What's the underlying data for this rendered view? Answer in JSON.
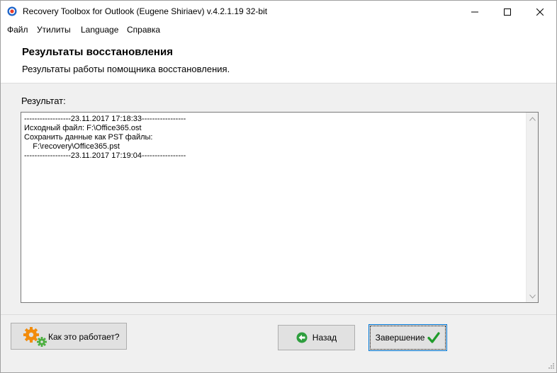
{
  "window": {
    "title": "Recovery Toolbox for Outlook (Eugene Shiriaev) v.4.2.1.19 32-bit"
  },
  "menu": {
    "items": [
      "Файл",
      "Утилиты",
      "Language",
      "Справка"
    ]
  },
  "header": {
    "title": "Результаты восстановления",
    "subtitle": "Результаты работы помощника восстановления."
  },
  "result": {
    "label": "Результат:",
    "log": "------------------23.11.2017 17:18:33-----------------\nИсходный файл: F:\\Office365.ost\nСохранить данные как PST файлы:\n    F:\\recovery\\Office365.pst\n------------------23.11.2017 17:19:04-----------------"
  },
  "buttons": {
    "how_it_works": "Как это работает?",
    "back": "Назад",
    "finish": "Завершение"
  },
  "colors": {
    "accent": "#0078d7",
    "back_icon": "#2e9e3e",
    "check_icon": "#1f9b2a",
    "gear_orange": "#f28c0c",
    "gear_green": "#4caf3f"
  }
}
